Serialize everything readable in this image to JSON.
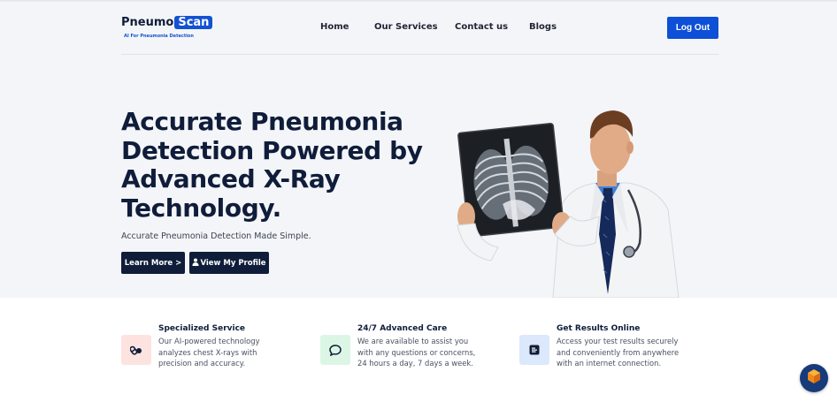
{
  "brand": {
    "name_part1": "Pneumo",
    "name_part2": "Scan",
    "tagline": "AI For Pneumonia Detection"
  },
  "nav": {
    "links": [
      "Home",
      "Our Services",
      "Contact us",
      "Blogs"
    ],
    "logout_label": "Log Out"
  },
  "hero": {
    "title": "Accurate Pneumonia Detection Powered by Advanced X-Ray Technology.",
    "subtitle": "Accurate Pneumonia Detection Made Simple.",
    "learn_more_label": "Learn More >",
    "profile_label": "View My Profile"
  },
  "features": [
    {
      "title": "Specialized Service",
      "description": "Our AI-powered technology analyzes chest X-rays with precision and accuracy.",
      "icon": "pills-icon",
      "icon_bg": "#fde3df",
      "icon_color": "#0f1d3a"
    },
    {
      "title": "24/7 Advanced Care",
      "description": "We are available to assist you with any questions or concerns, 24 hours a day, 7 days a week.",
      "icon": "chat-icon",
      "icon_bg": "#dcf6e6",
      "icon_color": "#0f1d3a"
    },
    {
      "title": "Get Results Online",
      "description": "Access your test results securely and conveniently from anywhere with an internet connection.",
      "icon": "document-icon",
      "icon_bg": "#dce8fb",
      "icon_color": "#0f1d3a"
    }
  ],
  "colors": {
    "primary": "#0d4fd6",
    "navy": "#0f1d3a",
    "background": "#f4f5f8"
  }
}
